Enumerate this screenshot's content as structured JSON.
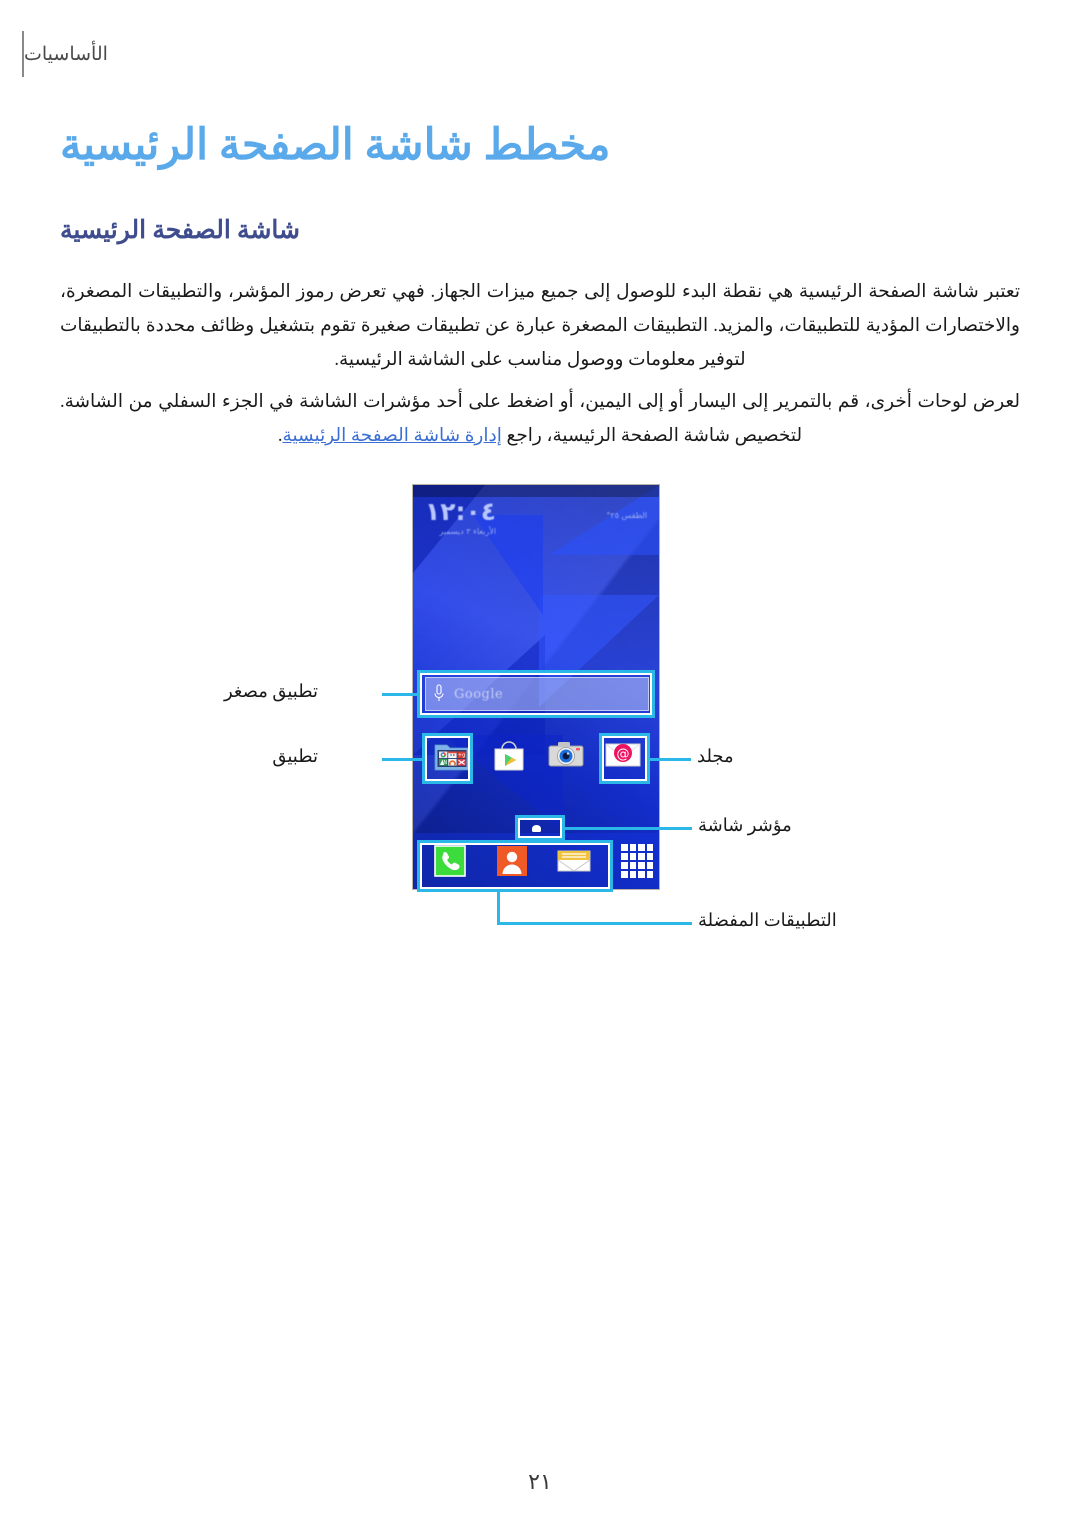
{
  "header": {
    "section_label": "الأساسيات"
  },
  "titles": {
    "main": "مخطط شاشة الصفحة الرئيسية",
    "sub": "شاشة الصفحة الرئيسية"
  },
  "paragraphs": {
    "p1": "تعتبر شاشة الصفحة الرئيسية هي نقطة البدء للوصول إلى جميع ميزات الجهاز. فهي تعرض رموز المؤشر، والتطبيقات المصغرة، والاختصارات المؤدية للتطبيقات، والمزيد. التطبيقات المصغرة عبارة عن تطبيقات صغيرة تقوم بتشغيل وظائف محددة بالتطبيقات لتوفير معلومات ووصول مناسب على الشاشة الرئيسية.",
    "p2_before": "لعرض لوحات أخرى، قم بالتمرير إلى اليسار أو إلى اليمين، أو اضغط على أحد مؤشرات الشاشة في الجزء السفلي من الشاشة. لتخصيص شاشة الصفحة الرئيسية، راجع ",
    "p2_link": "إدارة شاشة الصفحة الرئيسية",
    "p2_after": "."
  },
  "phone": {
    "clock_time": "١٢:٠٤",
    "clock_date": "الأربعاء ٣ ديسمبر",
    "weather": "الطقس ٢٥°",
    "search_widget": {
      "brand": "Google",
      "mic_icon": "microphone-icon"
    },
    "app_row": [
      {
        "name": "email-app-icon",
        "label": "البريد الإلكتروني"
      },
      {
        "name": "camera-app-icon",
        "label": "الكاميرا"
      },
      {
        "name": "play-store-app-icon",
        "label": "متجر Play"
      },
      {
        "name": "folder-icon",
        "label": "مجلد"
      }
    ],
    "dock": [
      {
        "name": "phone-app-icon",
        "label": "الهاتف"
      },
      {
        "name": "contacts-app-icon",
        "label": "جهات الاتصال"
      },
      {
        "name": "messages-app-icon",
        "label": "الرسائل"
      },
      {
        "name": "apps-grid-button",
        "label": "التطبيقات"
      }
    ],
    "page_indicator": "screen-indicator-dot"
  },
  "callouts": {
    "widget": "تطبيق مصغر",
    "app": "تطبيق",
    "folder": "مجلد",
    "screen_indicator": "مؤشر شاشة",
    "favorite_apps": "التطبيقات المفضلة"
  },
  "footer": {
    "page_number": "٢١"
  },
  "colors": {
    "title_main": "#5aa9ea",
    "title_sub": "#3f4d8f",
    "link": "#3b6fd4",
    "callout": "#2bb8e8",
    "wallpaper": "#1533e6"
  }
}
